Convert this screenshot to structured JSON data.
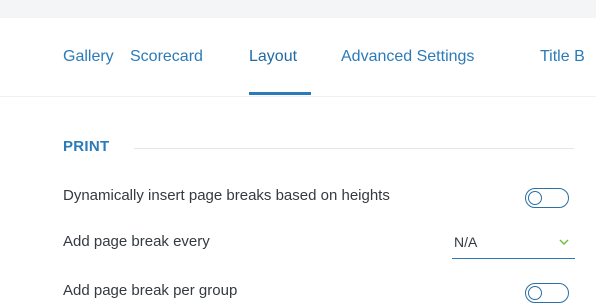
{
  "tabs": [
    {
      "label": "Gallery",
      "active": false
    },
    {
      "label": "Scorecard",
      "active": false
    },
    {
      "label": "Layout",
      "active": true
    },
    {
      "label": "Advanced Settings",
      "active": false
    },
    {
      "label": "Title B",
      "active": false
    }
  ],
  "section": {
    "title": "PRINT"
  },
  "settings": {
    "dynamic_breaks": {
      "label": "Dynamically insert page breaks based on heights",
      "enabled": false
    },
    "break_every": {
      "label": "Add page break every",
      "value": "N/A"
    },
    "break_per_group": {
      "label": "Add page break per group",
      "enabled": false
    }
  },
  "colors": {
    "accent": "#2b7bb9",
    "text": "#333a40",
    "chevron": "#6fbf3f"
  }
}
